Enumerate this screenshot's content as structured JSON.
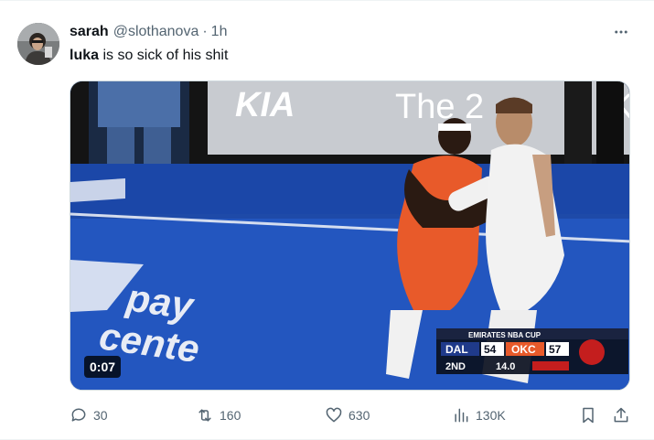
{
  "tweet": {
    "display_name": "sarah",
    "handle": "@slothanova",
    "separator": "·",
    "time": "1h",
    "text_bold": "luka",
    "text_rest": " is so sick of his shit"
  },
  "media": {
    "duration": "0:07",
    "scoreboard": {
      "event": "EMIRATES NBA CUP",
      "team_a": "DAL",
      "score_a": "54",
      "team_b": "OKC",
      "score_b": "57",
      "period": "2ND",
      "clock": "14.0"
    },
    "court_text_1": "pay",
    "court_text_2": "cente",
    "banner_brand": "KIA",
    "banner_text": "The 2",
    "banner_text_2": "K"
  },
  "actions": {
    "replies": "30",
    "reposts": "160",
    "likes": "630",
    "views": "130K"
  },
  "colors": {
    "text_primary": "#0f1419",
    "text_secondary": "#536471",
    "okc_orange": "#e85a2a",
    "court_blue": "#1f4fb5"
  }
}
